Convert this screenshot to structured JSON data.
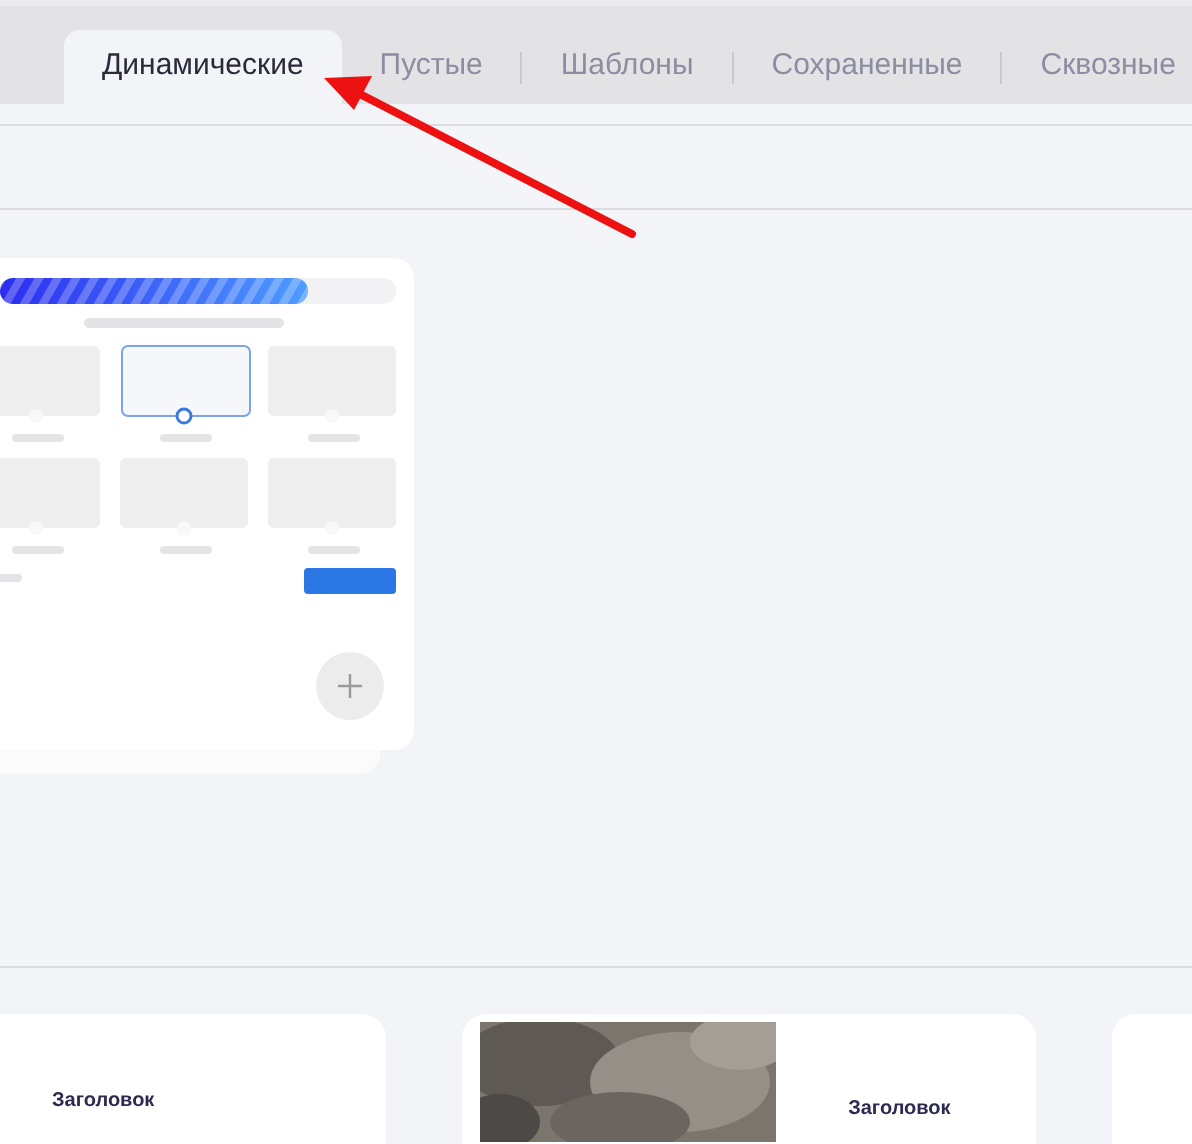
{
  "tabs": [
    {
      "label": "Динамические",
      "selected": true
    },
    {
      "label": "Пустые",
      "selected": false
    },
    {
      "label": "Шаблоны",
      "selected": false
    },
    {
      "label": "Сохраненные",
      "selected": false
    },
    {
      "label": "Сквозные",
      "selected": false
    }
  ],
  "cards": [
    {
      "title": "Заголовок",
      "kind": "text"
    },
    {
      "title": "Заголовок",
      "kind": "picture"
    }
  ]
}
